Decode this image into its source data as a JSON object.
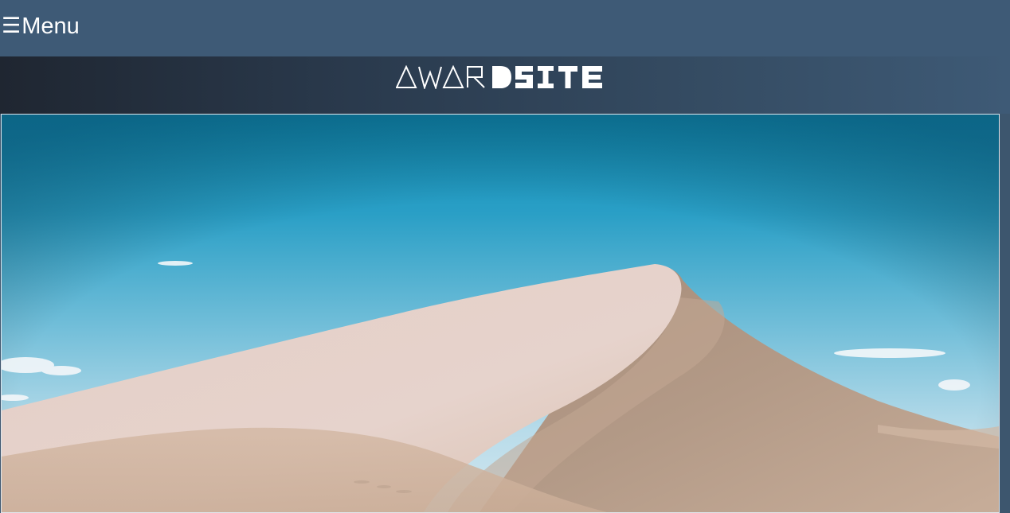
{
  "topbar": {
    "menu_icon": "hamburger-icon",
    "menu_label": "Menu",
    "background": "#3e5a76"
  },
  "logo": {
    "text": "AWARDSITE",
    "light_part": "AWAR",
    "bold_part": "DSITE",
    "color": "#ffffff"
  },
  "hero": {
    "description_image": "desert-dune-photo",
    "sky_color": "#2a9bc0",
    "sand_color": "#d9bfae"
  }
}
